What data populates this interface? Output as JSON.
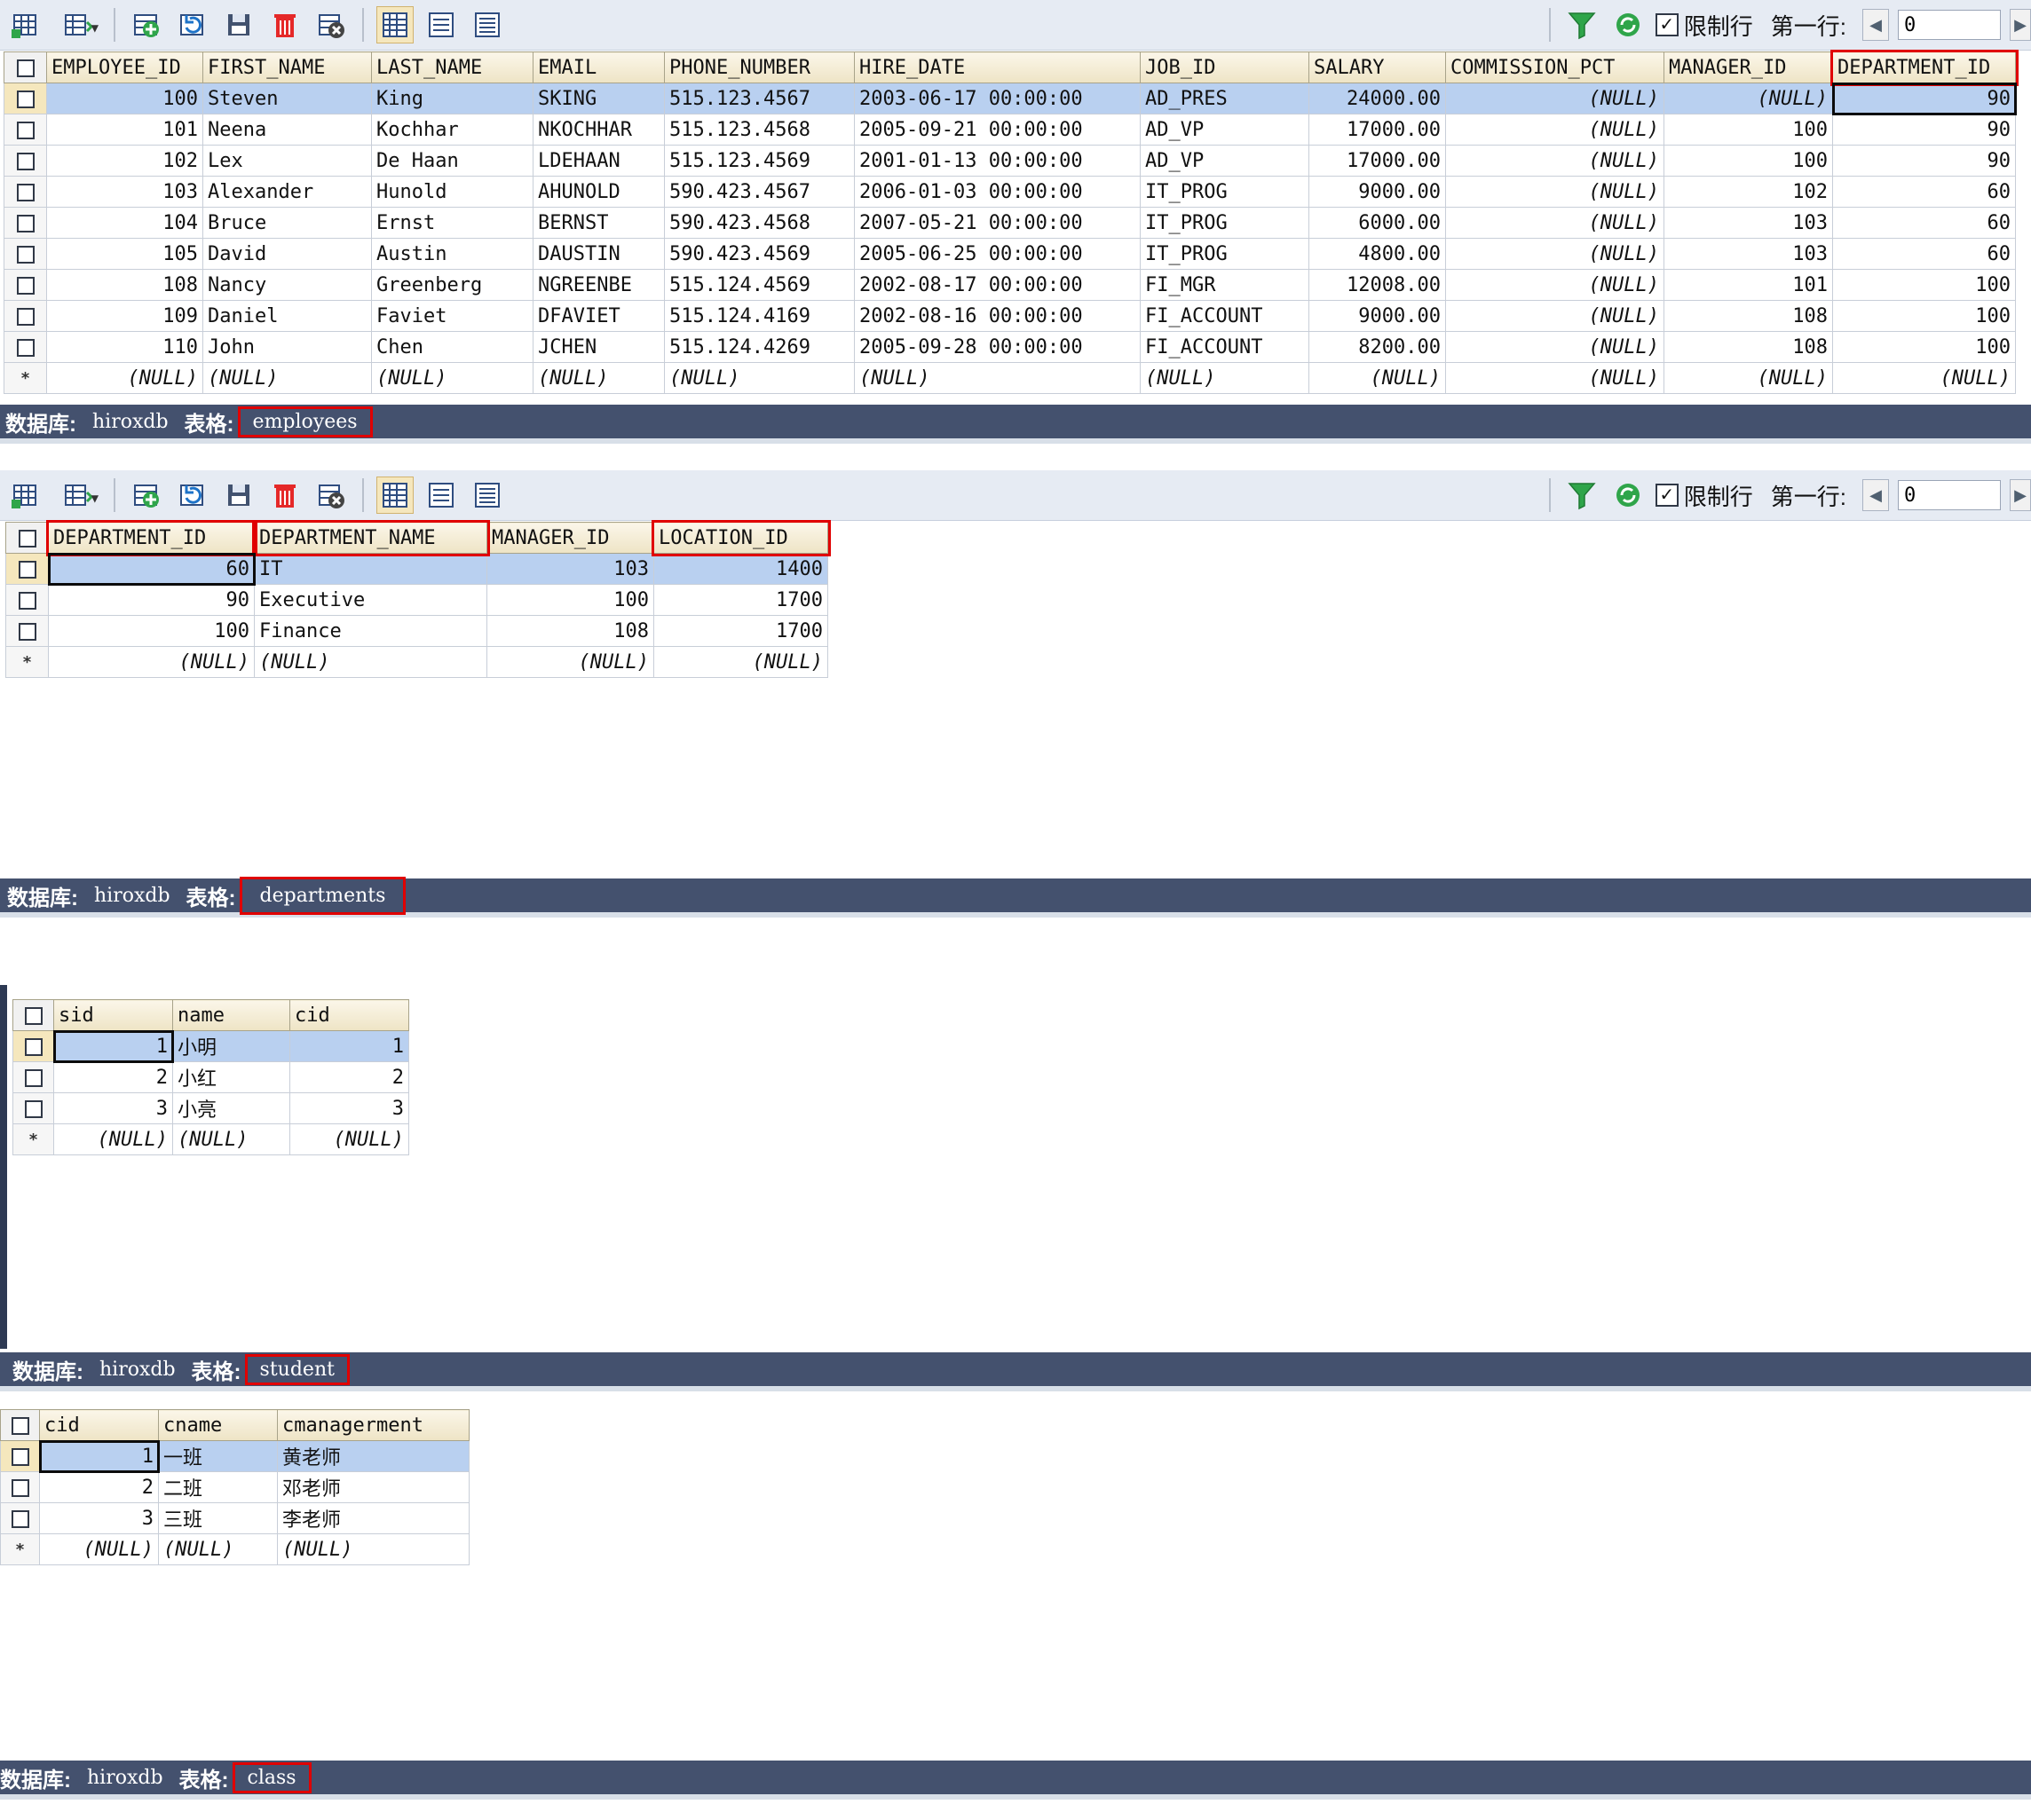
{
  "toolbar": {
    "icons": {
      "grid": "grid-icon",
      "export": "export-icon",
      "add": "add-row-icon",
      "refresh": "refresh-icon",
      "save": "save-icon",
      "delete": "delete-icon",
      "cancel": "cancel-icon",
      "view_grid": "grid-view-icon",
      "view_form": "form-view-icon",
      "view_text": "text-view-icon",
      "filter": "filter-icon",
      "reload": "reload-icon"
    },
    "limit_label": "限制行",
    "first_row_label": "第一行:",
    "first_row_value": "0"
  },
  "status_labels": {
    "database_label": "数据库:",
    "table_label": "表格:",
    "database_name": "hiroxdb"
  },
  "employees": {
    "table_name": "employees",
    "columns": [
      "EMPLOYEE_ID",
      "FIRST_NAME",
      "LAST_NAME",
      "EMAIL",
      "PHONE_NUMBER",
      "HIRE_DATE",
      "JOB_ID",
      "SALARY",
      "COMMISSION_PCT",
      "MANAGER_ID",
      "DEPARTMENT_ID"
    ],
    "rows": [
      [
        "100",
        "Steven",
        "King",
        "SKING",
        "515.123.4567",
        "2003-06-17 00:00:00",
        "AD_PRES",
        "24000.00",
        "(NULL)",
        "(NULL)",
        "90"
      ],
      [
        "101",
        "Neena",
        "Kochhar",
        "NKOCHHAR",
        "515.123.4568",
        "2005-09-21 00:00:00",
        "AD_VP",
        "17000.00",
        "(NULL)",
        "100",
        "90"
      ],
      [
        "102",
        "Lex",
        "De Haan",
        "LDEHAAN",
        "515.123.4569",
        "2001-01-13 00:00:00",
        "AD_VP",
        "17000.00",
        "(NULL)",
        "100",
        "90"
      ],
      [
        "103",
        "Alexander",
        "Hunold",
        "AHUNOLD",
        "590.423.4567",
        "2006-01-03 00:00:00",
        "IT_PROG",
        "9000.00",
        "(NULL)",
        "102",
        "60"
      ],
      [
        "104",
        "Bruce",
        "Ernst",
        "BERNST",
        "590.423.4568",
        "2007-05-21 00:00:00",
        "IT_PROG",
        "6000.00",
        "(NULL)",
        "103",
        "60"
      ],
      [
        "105",
        "David",
        "Austin",
        "DAUSTIN",
        "590.423.4569",
        "2005-06-25 00:00:00",
        "IT_PROG",
        "4800.00",
        "(NULL)",
        "103",
        "60"
      ],
      [
        "108",
        "Nancy",
        "Greenberg",
        "NGREENBE",
        "515.124.4569",
        "2002-08-17 00:00:00",
        "FI_MGR",
        "12008.00",
        "(NULL)",
        "101",
        "100"
      ],
      [
        "109",
        "Daniel",
        "Faviet",
        "DFAVIET",
        "515.124.4169",
        "2002-08-16 00:00:00",
        "FI_ACCOUNT",
        "9000.00",
        "(NULL)",
        "108",
        "100"
      ],
      [
        "110",
        "John",
        "Chen",
        "JCHEN",
        "515.124.4269",
        "2005-09-28 00:00:00",
        "FI_ACCOUNT",
        "8200.00",
        "(NULL)",
        "108",
        "100"
      ]
    ],
    "null_row": [
      "(NULL)",
      "(NULL)",
      "(NULL)",
      "(NULL)",
      "(NULL)",
      "(NULL)",
      "(NULL)",
      "(NULL)",
      "(NULL)",
      "(NULL)",
      "(NULL)"
    ]
  },
  "departments": {
    "table_name": "departments",
    "columns": [
      "DEPARTMENT_ID",
      "DEPARTMENT_NAME",
      "MANAGER_ID",
      "LOCATION_ID"
    ],
    "rows": [
      [
        "60",
        "IT",
        "103",
        "1400"
      ],
      [
        "90",
        "Executive",
        "100",
        "1700"
      ],
      [
        "100",
        "Finance",
        "108",
        "1700"
      ]
    ],
    "null_row": [
      "(NULL)",
      "(NULL)",
      "(NULL)",
      "(NULL)"
    ]
  },
  "student": {
    "table_name": "student",
    "columns": [
      "sid",
      "name",
      "cid"
    ],
    "rows": [
      [
        "1",
        "小明",
        "1"
      ],
      [
        "2",
        "小红",
        "2"
      ],
      [
        "3",
        "小亮",
        "3"
      ]
    ],
    "null_row": [
      "(NULL)",
      "(NULL)",
      "(NULL)"
    ]
  },
  "class": {
    "table_name": "class",
    "columns": [
      "cid",
      "cname",
      "cmanagerment"
    ],
    "rows": [
      [
        "1",
        "一班",
        "黄老师"
      ],
      [
        "2",
        "二班",
        "邓老师"
      ],
      [
        "3",
        "三班",
        "李老师"
      ]
    ],
    "null_row": [
      "(NULL)",
      "(NULL)",
      "(NULL)"
    ]
  },
  "colors": {
    "highlight": "#e00000",
    "status_bar": "#44516e",
    "selected_row": "#b9d0f0"
  }
}
